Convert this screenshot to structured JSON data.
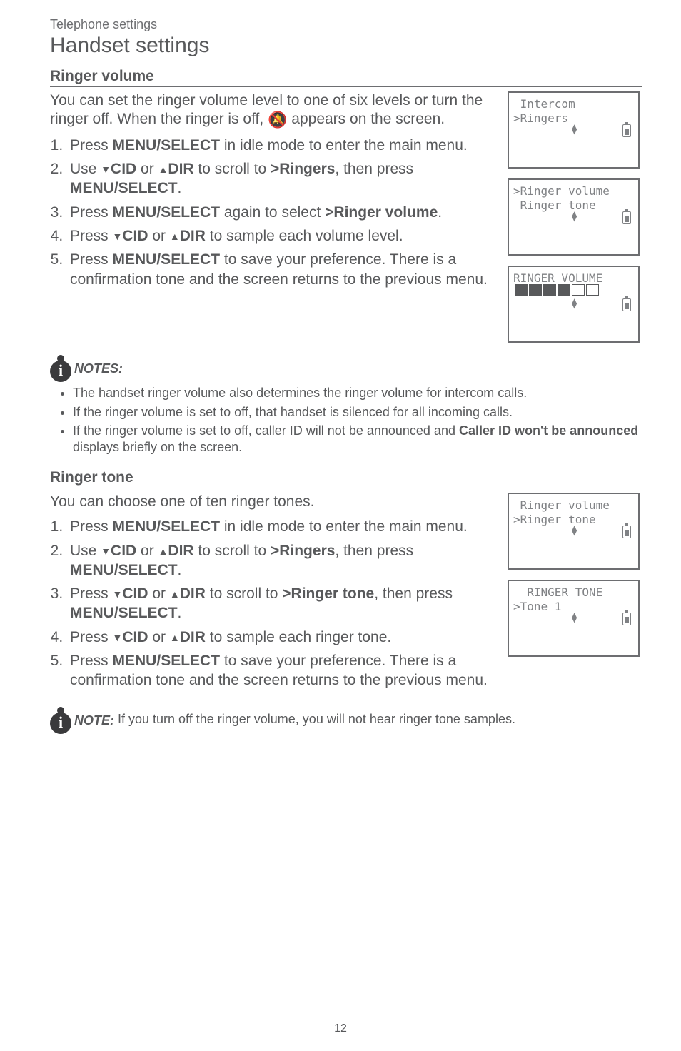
{
  "breadcrumb": "Telephone settings",
  "page_title": "Handset settings",
  "page_number": "12",
  "ringer_volume": {
    "heading": "Ringer volume",
    "intro_a": "You can set the ringer volume level to one of six levels or turn the ringer off. When the ringer is off, ",
    "intro_b": " appears on the screen.",
    "steps": {
      "s1_a": "Press ",
      "s1_b": "MENU/",
      "s1_c": "SELECT",
      "s1_d": " in idle mode to enter the main menu.",
      "s2_a": "Use ",
      "s2_cid": "CID",
      "s2_or": " or ",
      "s2_dir": "DIR",
      "s2_b": " to scroll to ",
      "s2_ringers": ">Ringers",
      "s2_c": ", then press ",
      "s2_menu": "MENU",
      "s2_sel": "/SELECT",
      "s2_end": ".",
      "s3_a": "Press ",
      "s3_menu": "MENU",
      "s3_sel": "/SELECT",
      "s3_b": " again to select ",
      "s3_rv": ">Ringer volume",
      "s3_end": ".",
      "s4_a": "Press ",
      "s4_cid": "CID",
      "s4_or": " or ",
      "s4_dir": "DIR",
      "s4_b": " to sample each volume level.",
      "s5_a": "Press ",
      "s5_menu": "MENU",
      "s5_sel": "/SELECT",
      "s5_b": " to save your preference. There is a confirmation tone and the screen returns to the previous menu."
    },
    "notes_label": "NOTES:",
    "notes": [
      "The handset ringer volume also determines the ringer volume for intercom calls.",
      "If the ringer volume is set to off, that handset is silenced for all incoming calls."
    ],
    "note3_a": "If the ringer volume is set to off, caller ID will not be announced and ",
    "note3_b": "Caller ID won't be announced",
    "note3_c": " displays briefly on the screen.",
    "screens": {
      "a1": " Intercom",
      "a2": ">Ringers",
      "b1": ">Ringer volume",
      "b2": " Ringer tone",
      "c1": "RINGER VOLUME"
    }
  },
  "ringer_tone": {
    "heading": "Ringer tone",
    "intro": "You can choose one of ten ringer tones.",
    "steps": {
      "s1_a": "Press ",
      "s1_b": "MENU/",
      "s1_c": "SELECT",
      "s1_d": " in idle mode to enter the main menu.",
      "s2_a": "Use ",
      "s2_cid": "CID",
      "s2_or": " or ",
      "s2_dir": "DIR",
      "s2_b": " to scroll to ",
      "s2_ringers": ">Ringers",
      "s2_c": ", then press ",
      "s2_menu": "MENU",
      "s2_sel": "/SELECT",
      "s2_end": ".",
      "s3_a": "Press ",
      "s3_cid": "CID",
      "s3_or": " or ",
      "s3_dir": "DIR",
      "s3_b": " to scroll to ",
      "s3_rt": ">Ringer tone",
      "s3_c": ", then press ",
      "s3_menu": "MENU",
      "s3_sel": "/SELECT",
      "s3_end": ".",
      "s4_a": "Press ",
      "s4_cid": "CID",
      "s4_or": " or ",
      "s4_dir": "DIR",
      "s4_b": " to sample each ringer tone.",
      "s5_a": "Press ",
      "s5_menu": "MENU",
      "s5_sel": "/SELECT",
      "s5_b": " to save your preference. There is a confirmation tone and the screen returns to the previous menu."
    },
    "note_label": "NOTE:",
    "note_text": " If you turn off the ringer volume, you will not hear ringer tone samples.",
    "screens": {
      "a1": " Ringer volume",
      "a2": ">Ringer tone",
      "b1": "  RINGER TONE",
      "b2": ">Tone 1"
    }
  }
}
